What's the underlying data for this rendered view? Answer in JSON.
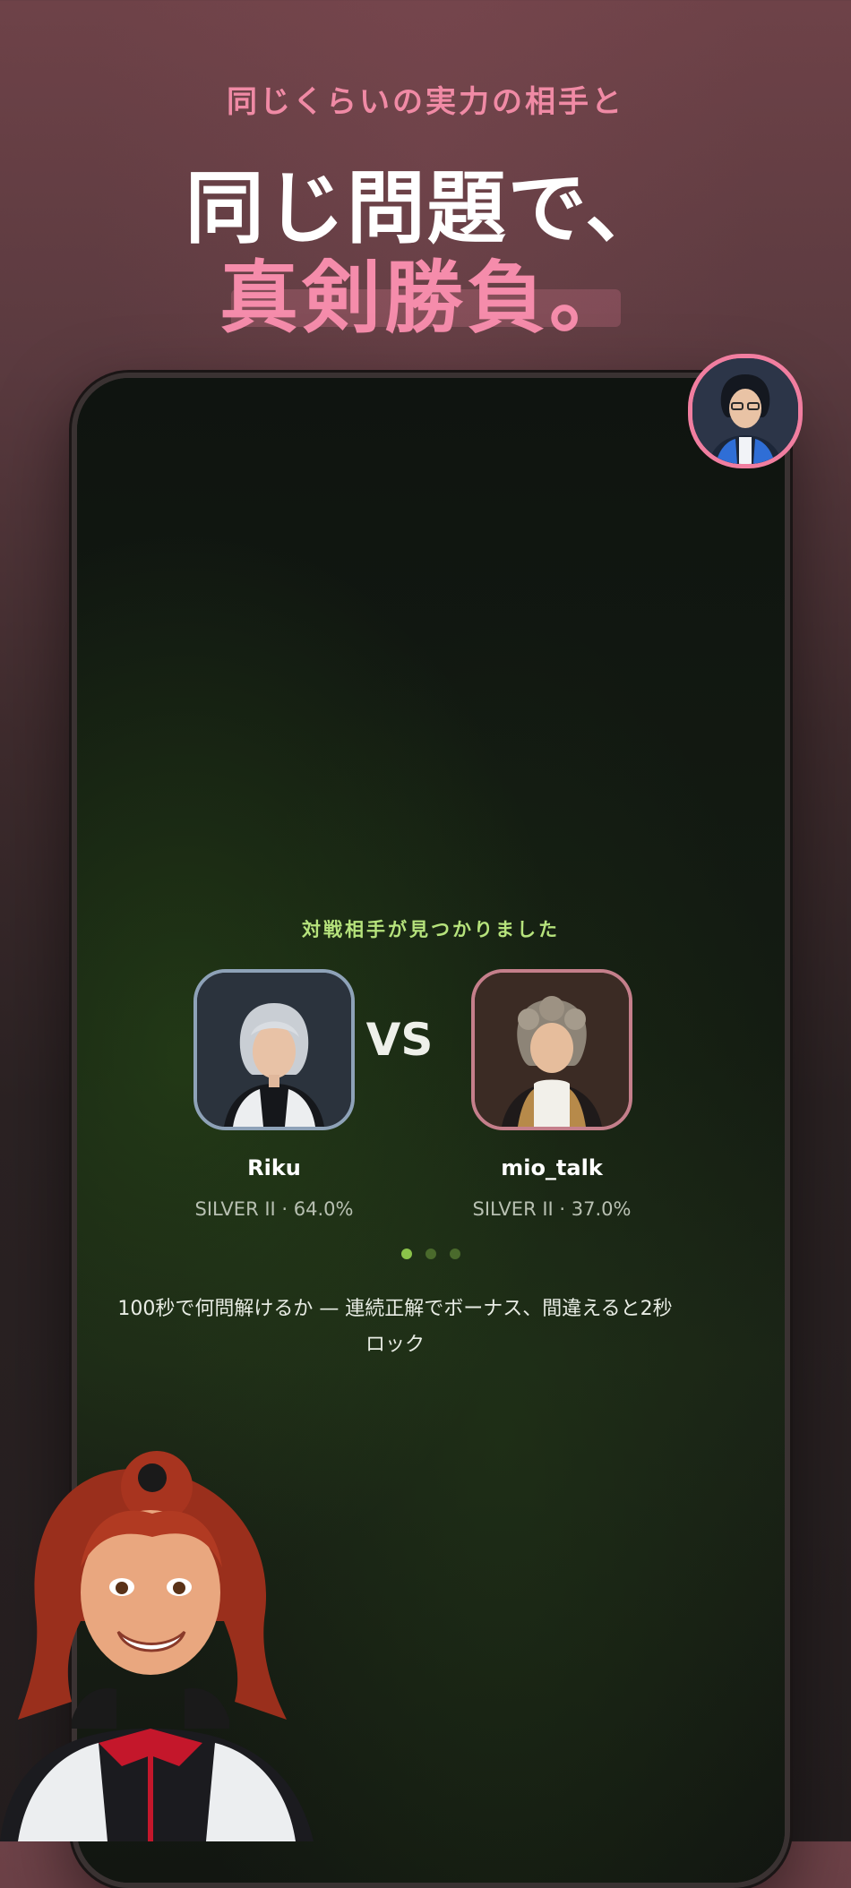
{
  "hero": {
    "eyebrow": "同じくらいの実力の相手と",
    "headline_line1": "同じ問題で、",
    "headline_line2": "真剣勝負。"
  },
  "match": {
    "title": "対戦相手が見つかりました",
    "vs_label": "VS",
    "players": [
      {
        "name": "Riku",
        "rank": "SILVER II · 64.0%",
        "accent": "#8ea2b8"
      },
      {
        "name": "mio_talk",
        "rank": "SILVER II · 37.0%",
        "accent": "#c57f8b"
      }
    ],
    "carousel": {
      "total": 3,
      "active": 1
    },
    "rule_text": "100秒で何問解けるか — 連続正解でボーナス、間違えると2秒ロック"
  },
  "colors": {
    "accent_pink": "#f58cab",
    "accent_green": "#b6e37c"
  }
}
